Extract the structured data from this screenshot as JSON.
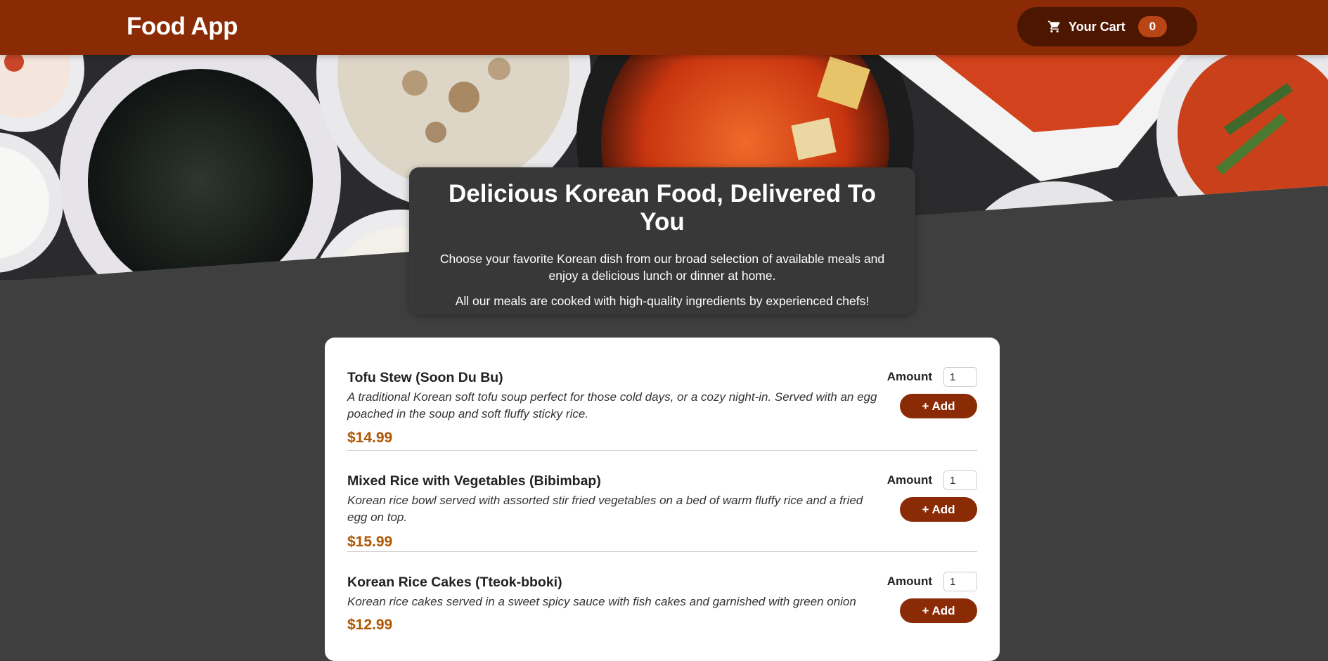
{
  "header": {
    "title": "Food App",
    "cart": {
      "label": "Your Cart",
      "count": "0",
      "icon": "cart-icon"
    }
  },
  "summary": {
    "title": "Delicious Korean Food, Delivered To You",
    "paragraph1": "Choose your favorite Korean dish from our broad selection of available meals and enjoy a delicious lunch or dinner at home.",
    "paragraph2": "All our meals are cooked with high-quality ingredients by experienced chefs!"
  },
  "meals": [
    {
      "name": "Tofu Stew (Soon Du Bu)",
      "description": "A traditional Korean soft tofu soup perfect for those cold days, or a cozy night-in. Served with an egg poached in the soup and soft fluffy sticky rice.",
      "price": "$14.99",
      "amount_label": "Amount",
      "amount_value": "1",
      "add_label": "+ Add"
    },
    {
      "name": "Mixed Rice with Vegetables (Bibimbap)",
      "description": "Korean rice bowl served with assorted stir fried vegetables on a bed of warm fluffy rice and a fried egg on top.",
      "price": "$15.99",
      "amount_label": "Amount",
      "amount_value": "1",
      "add_label": "+ Add"
    },
    {
      "name": "Korean Rice Cakes (Tteok-bboki)",
      "description": "Korean rice cakes served in a sweet spicy sauce with fish cakes and garnished with green onion",
      "price": "$12.99",
      "amount_label": "Amount",
      "amount_value": "1",
      "add_label": "+ Add"
    }
  ],
  "colors": {
    "header_bg": "#8a2b06",
    "cart_bg": "#4d1601",
    "badge_bg": "#b94517",
    "page_bg": "#3f3f3f",
    "price": "#ad5502"
  }
}
